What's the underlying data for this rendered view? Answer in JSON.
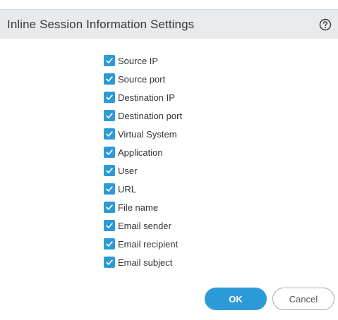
{
  "dialog": {
    "title": "Inline Session Information Settings",
    "help_icon": "question-circle-icon"
  },
  "options": [
    {
      "label": "Source IP",
      "checked": true
    },
    {
      "label": "Source port",
      "checked": true
    },
    {
      "label": "Destination IP",
      "checked": true
    },
    {
      "label": "Destination port",
      "checked": true
    },
    {
      "label": "Virtual System",
      "checked": true
    },
    {
      "label": "Application",
      "checked": true
    },
    {
      "label": "User",
      "checked": true
    },
    {
      "label": "URL",
      "checked": true
    },
    {
      "label": "File name",
      "checked": true
    },
    {
      "label": "Email sender",
      "checked": true
    },
    {
      "label": "Email recipient",
      "checked": true
    },
    {
      "label": "Email subject",
      "checked": true
    }
  ],
  "buttons": {
    "ok_label": "OK",
    "cancel_label": "Cancel"
  },
  "colors": {
    "accent": "#2d9ad8",
    "title_bar": "#e8eaec"
  }
}
